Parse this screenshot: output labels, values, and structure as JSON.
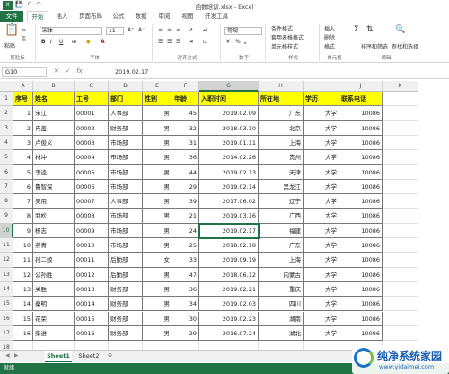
{
  "titlebar": {
    "title": "函数培训.xlsx - Excel",
    "save": "💾",
    "undo": "↶",
    "redo": "↷"
  },
  "ribbon_tabs": [
    "文件",
    "开始",
    "插入",
    "页面布局",
    "公式",
    "数据",
    "审阅",
    "视图",
    "开发工具"
  ],
  "ribbon": {
    "clipboard_label": "剪贴板",
    "paste_label": "粘贴",
    "font_name": "宋体",
    "font_size": "11",
    "font_label": "字体",
    "bold": "B",
    "italic": "I",
    "underline": "U",
    "align_label": "对齐方式",
    "number_format": "常规",
    "number_label": "数字",
    "percent": "%",
    "comma": ",",
    "cond_format": "条件格式",
    "table_format": "套用表格格式",
    "cell_style": "单元格样式",
    "style_label": "样式",
    "insert": "插入",
    "delete": "删除",
    "format": "格式",
    "cells_label": "单元格",
    "sort_filter": "排序和筛选",
    "find_select": "查找和选择",
    "edit_label": "编辑",
    "sum": "Σ"
  },
  "formula_bar": {
    "name_box": "G10",
    "cancel": "✕",
    "enter": "✓",
    "fx": "fx",
    "value": "2019.02.17"
  },
  "columns": [
    "A",
    "B",
    "C",
    "D",
    "E",
    "F",
    "G",
    "H",
    "I",
    "J",
    "K"
  ],
  "selected_cell": "G10",
  "headers": [
    "序号",
    "姓名",
    "工号",
    "部门",
    "性别",
    "年龄",
    "入职时间",
    "所在地",
    "学历",
    "联系电话"
  ],
  "rows": [
    [
      "1",
      "宋江",
      "00001",
      "人事部",
      "男",
      "45",
      "2019.02.09",
      "广东",
      "大学",
      "10086"
    ],
    [
      "2",
      "冉盖",
      "00002",
      "财务部",
      "男",
      "32",
      "2018.03.10",
      "北京",
      "大学",
      "10086"
    ],
    [
      "3",
      "卢俊义",
      "00003",
      "市场部",
      "男",
      "31",
      "2019.01.11",
      "上海",
      "大学",
      "10086"
    ],
    [
      "4",
      "林冲",
      "00004",
      "市场部",
      "男",
      "36",
      "2014.02.26",
      "贵州",
      "大学",
      "10086"
    ],
    [
      "5",
      "李逵",
      "00005",
      "市场部",
      "男",
      "44",
      "2019.02.13",
      "天津",
      "大学",
      "10086"
    ],
    [
      "6",
      "鲁智深",
      "00006",
      "市场部",
      "男",
      "29",
      "2019.02.14",
      "黑龙江",
      "大学",
      "10086"
    ],
    [
      "7",
      "吴用",
      "00007",
      "人事部",
      "男",
      "39",
      "2017.06.02",
      "辽宁",
      "大学",
      "10086"
    ],
    [
      "8",
      "武松",
      "00008",
      "市场部",
      "男",
      "21",
      "2019.03.16",
      "广西",
      "大学",
      "10086"
    ],
    [
      "9",
      "杨志",
      "00009",
      "市场部",
      "男",
      "24",
      "2019.02.17",
      "福建",
      "大学",
      "10086"
    ],
    [
      "10",
      "燕青",
      "00010",
      "市场部",
      "男",
      "25",
      "2018.02.18",
      "广东",
      "大学",
      "10086"
    ],
    [
      "11",
      "孙二娘",
      "00011",
      "后勤部",
      "女",
      "33",
      "2019.09.19",
      "上海",
      "大学",
      "10086"
    ],
    [
      "12",
      "公孙胜",
      "00012",
      "后勤部",
      "男",
      "47",
      "2018.06.12",
      "内蒙古",
      "大学",
      "10086"
    ],
    [
      "13",
      "关胜",
      "00013",
      "财务部",
      "男",
      "36",
      "2019.02.21",
      "重庆",
      "大学",
      "10086"
    ],
    [
      "14",
      "秦明",
      "00014",
      "财务部",
      "男",
      "34",
      "2019.02.03",
      "四川",
      "大学",
      "10086"
    ],
    [
      "15",
      "花荣",
      "00015",
      "财务部",
      "男",
      "30",
      "2019.02.23",
      "湖南",
      "大学",
      "10086"
    ],
    [
      "16",
      "柴进",
      "00016",
      "财务部",
      "男",
      "29",
      "2016.07.24",
      "湖北",
      "大学",
      "10086"
    ]
  ],
  "row_numbers": [
    "1",
    "2",
    "3",
    "4",
    "5",
    "6",
    "7",
    "8",
    "9",
    "10",
    "11",
    "12",
    "13",
    "14",
    "15",
    "16",
    "17",
    "18"
  ],
  "sheet_tabs": [
    "Sheet1",
    "Sheet2"
  ],
  "add_sheet": "⊕",
  "status_text": "就绪",
  "watermark": {
    "line1": "纯净系统家园",
    "line2": "www.yidaimei.com"
  },
  "colors": {
    "accent": "#217346",
    "header_fill": "#ffff00"
  }
}
